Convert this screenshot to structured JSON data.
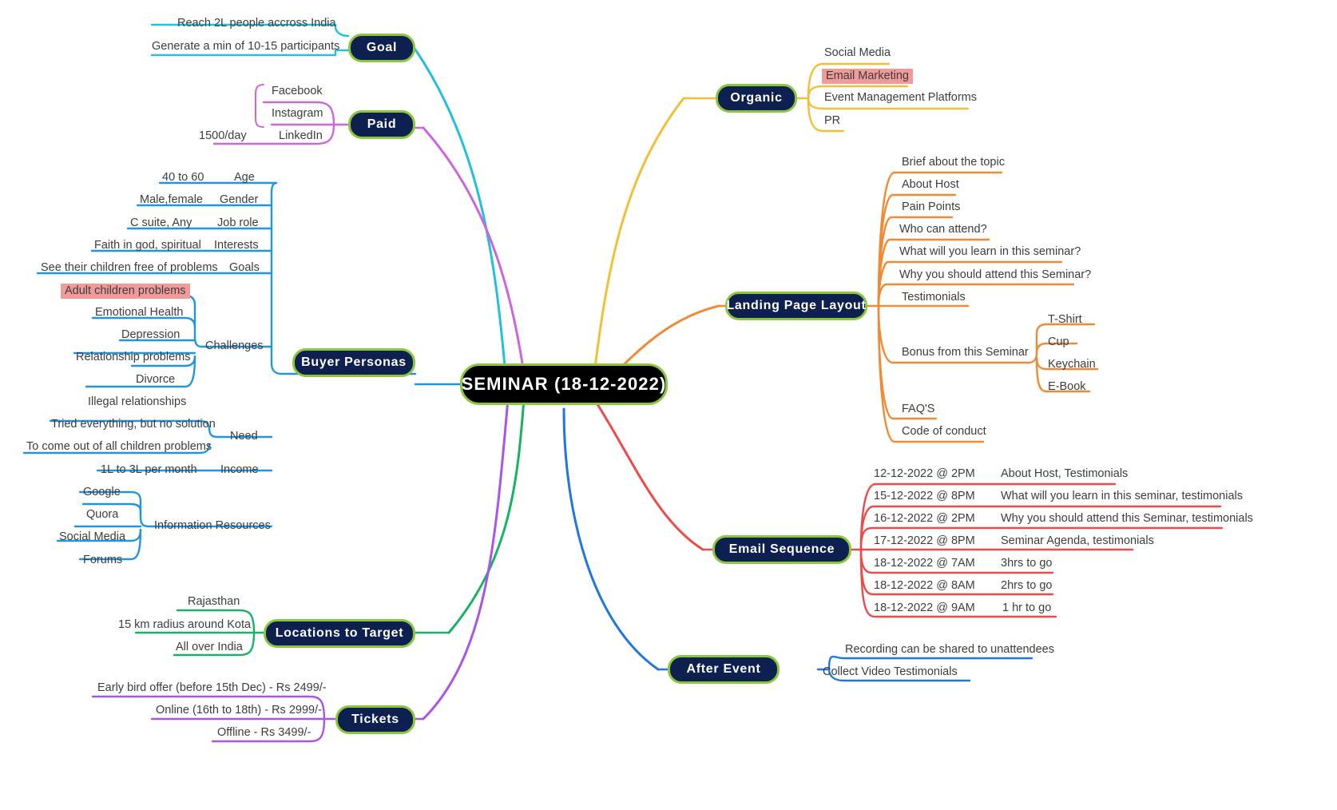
{
  "diagram": {
    "type": "mindmap",
    "title": "SEMINAR (18-12-2022)",
    "center": {
      "label": "SEMINAR (18-12-2022)"
    },
    "colors": {
      "center_fill": "#000000",
      "node_fill": "#0d2050",
      "node_border": "#8cc63e",
      "highlight": "#f09a9a",
      "goal": "#22c0dd",
      "paid": "#cc66dd",
      "buyer_personas": "#2196e0",
      "locations": "#16b364",
      "tickets": "#a855e8",
      "organic": "#f2c037",
      "landing_page": "#f08a35",
      "email_sequence": "#ef4a4a",
      "after_event": "#2176e0"
    },
    "branches": [
      {
        "id": "goal",
        "label": "Goal",
        "side": "left",
        "color": "#22c0dd",
        "children": [
          {
            "label": "Reach 2L people accross India"
          },
          {
            "label": "Generate a min of 10-15 participants"
          }
        ]
      },
      {
        "id": "paid",
        "label": "Paid",
        "side": "left",
        "color": "#cc66dd",
        "children": [
          {
            "label": "Facebook"
          },
          {
            "label": "Instagram"
          },
          {
            "label": "LinkedIn",
            "children": [
              {
                "label": "1500/day"
              }
            ]
          }
        ]
      },
      {
        "id": "buyer-personas",
        "label": "Buyer Personas",
        "side": "left",
        "color": "#2196e0",
        "children": [
          {
            "label": "Age",
            "children": [
              {
                "label": "40 to 60"
              }
            ]
          },
          {
            "label": "Gender",
            "children": [
              {
                "label": "Male,female"
              }
            ]
          },
          {
            "label": "Job role",
            "children": [
              {
                "label": "C suite, Any"
              }
            ]
          },
          {
            "label": "Interests",
            "children": [
              {
                "label": "Faith in god, spiritual"
              }
            ]
          },
          {
            "label": "Goals",
            "children": [
              {
                "label": "See their children free of problems"
              }
            ]
          },
          {
            "label": "Challenges",
            "children": [
              {
                "label": "Adult children problems",
                "highlight": true
              },
              {
                "label": "Emotional Health"
              },
              {
                "label": "Depression"
              },
              {
                "label": "Relationship problems"
              },
              {
                "label": "Divorce"
              },
              {
                "label": "Illegal relationships"
              }
            ]
          },
          {
            "label": "Need",
            "children": [
              {
                "label": "Tried everything, but no solution"
              },
              {
                "label": "To come out of all children problems"
              }
            ]
          },
          {
            "label": "Income",
            "children": [
              {
                "label": "1L to 3L per month"
              }
            ]
          },
          {
            "label": "Information Resources",
            "children": [
              {
                "label": "Google"
              },
              {
                "label": "Quora"
              },
              {
                "label": "Social Media"
              },
              {
                "label": "Forums"
              }
            ]
          }
        ]
      },
      {
        "id": "locations-to-target",
        "label": "Locations to Target",
        "side": "left",
        "color": "#16b364",
        "children": [
          {
            "label": "Rajasthan"
          },
          {
            "label": "15 km radius around Kota"
          },
          {
            "label": "All over India"
          }
        ]
      },
      {
        "id": "tickets",
        "label": "Tickets",
        "side": "left",
        "color": "#a855e8",
        "children": [
          {
            "label": "Early bird offer (before 15th Dec) - Rs 2499/-"
          },
          {
            "label": "Online (16th to 18th) - Rs 2999/-"
          },
          {
            "label": "Offline - Rs 3499/-"
          }
        ]
      },
      {
        "id": "organic",
        "label": "Organic",
        "side": "right",
        "color": "#f2c037",
        "children": [
          {
            "label": "Social Media"
          },
          {
            "label": "Email Marketing",
            "highlight": true
          },
          {
            "label": "Event Management Platforms"
          },
          {
            "label": "PR"
          }
        ]
      },
      {
        "id": "landing-page-layout",
        "label": "Landing Page Layout",
        "side": "right",
        "color": "#f08a35",
        "children": [
          {
            "label": "Brief about the topic"
          },
          {
            "label": "About Host"
          },
          {
            "label": "Pain Points"
          },
          {
            "label": "Who can attend?"
          },
          {
            "label": "What will you learn in this seminar?"
          },
          {
            "label": "Why you should attend this Seminar?"
          },
          {
            "label": "Testimonials"
          },
          {
            "label": "Bonus from this Seminar",
            "children": [
              {
                "label": "T-Shirt"
              },
              {
                "label": "Cup"
              },
              {
                "label": "Keychain"
              },
              {
                "label": "E-Book"
              }
            ]
          },
          {
            "label": "FAQ'S"
          },
          {
            "label": "Code of conduct"
          }
        ]
      },
      {
        "id": "email-sequence",
        "label": "Email Sequence",
        "side": "right",
        "color": "#ef4a4a",
        "children": [
          {
            "label": "12-12-2022 @ 2PM",
            "children": [
              {
                "label": "About Host, Testimonials"
              }
            ]
          },
          {
            "label": "15-12-2022 @ 8PM",
            "children": [
              {
                "label": "What will you learn in this seminar, testimonials"
              }
            ]
          },
          {
            "label": "16-12-2022 @ 2PM",
            "children": [
              {
                "label": "Why you should attend this Seminar, testimonials"
              }
            ]
          },
          {
            "label": "17-12-2022 @ 8PM",
            "children": [
              {
                "label": "Seminar Agenda, testimonials"
              }
            ]
          },
          {
            "label": "18-12-2022 @ 7AM",
            "children": [
              {
                "label": "3hrs to go"
              }
            ]
          },
          {
            "label": "18-12-2022 @ 8AM",
            "children": [
              {
                "label": "2hrs to go"
              }
            ]
          },
          {
            "label": "18-12-2022 @ 9AM",
            "children": [
              {
                "label": "1 hr to go"
              }
            ]
          }
        ]
      },
      {
        "id": "after-event",
        "label": "After Event",
        "side": "right",
        "color": "#2176e0",
        "children": [
          {
            "label": "Recording can be shared to unattendees"
          },
          {
            "label": "Collect Video Testimonials"
          }
        ]
      }
    ]
  },
  "nodes": {
    "center": "SEMINAR (18-12-2022)",
    "goal": "Goal",
    "paid": "Paid",
    "buyer_personas": "Buyer Personas",
    "locations": "Locations to Target",
    "tickets": "Tickets",
    "organic": "Organic",
    "landing": "Landing Page Layout",
    "email_sequence": "Email Sequence",
    "after_event": "After Event"
  },
  "labels": {
    "goal": [
      "Reach 2L people accross India",
      "Generate a min of 10-15 participants"
    ],
    "paid": [
      "Facebook",
      "Instagram",
      "LinkedIn"
    ],
    "paid_sub": [
      "1500/day"
    ],
    "bp_cats": [
      "Age",
      "Gender",
      "Job role",
      "Interests",
      "Goals",
      "Challenges",
      "Need",
      "Income",
      "Information Resources"
    ],
    "bp_age": "40 to 60",
    "bp_gender": "Male,female",
    "bp_job": "C suite, Any",
    "bp_interests": "Faith in god, spiritual",
    "bp_goals": "See their children free of problems",
    "bp_challenges": [
      "Adult children problems",
      "Emotional Health",
      "Depression",
      "Relationship problems",
      "Divorce",
      "Illegal relationships"
    ],
    "bp_need": [
      "Tried everything, but no solution",
      "To come out of all children problems"
    ],
    "bp_income": "1L to 3L per month",
    "bp_info": [
      "Google",
      "Quora",
      "Social Media",
      "Forums"
    ],
    "locations": [
      "Rajasthan",
      "15 km radius around Kota",
      "All over India"
    ],
    "tickets": [
      "Early bird offer (before 15th Dec) - Rs 2499/-",
      "Online (16th to 18th) - Rs 2999/-",
      "Offline - Rs 3499/-"
    ],
    "organic": [
      "Social Media",
      "Email Marketing",
      "Event Management Platforms",
      "PR"
    ],
    "landing": [
      "Brief about the topic",
      "About Host",
      "Pain Points",
      "Who can attend?",
      "What will you learn in this seminar?",
      "Why you should attend this Seminar?",
      "Testimonials",
      "Bonus from this Seminar",
      "FAQ'S",
      "Code of conduct"
    ],
    "bonus": [
      "T-Shirt",
      "Cup",
      "Keychain",
      "E-Book"
    ],
    "email_times": [
      "12-12-2022 @ 2PM",
      "15-12-2022 @ 8PM",
      "16-12-2022 @ 2PM",
      "17-12-2022 @ 8PM",
      "18-12-2022 @ 7AM",
      "18-12-2022 @ 8AM",
      "18-12-2022 @ 9AM"
    ],
    "email_topics": [
      "About Host, Testimonials",
      "What will you learn in this seminar, testimonials",
      "Why you should attend this Seminar, testimonials",
      "Seminar Agenda, testimonials",
      "3hrs to go",
      "2hrs to go",
      "1 hr to go"
    ],
    "after_event": [
      "Recording can be shared to unattendees",
      "Collect Video Testimonials"
    ]
  }
}
